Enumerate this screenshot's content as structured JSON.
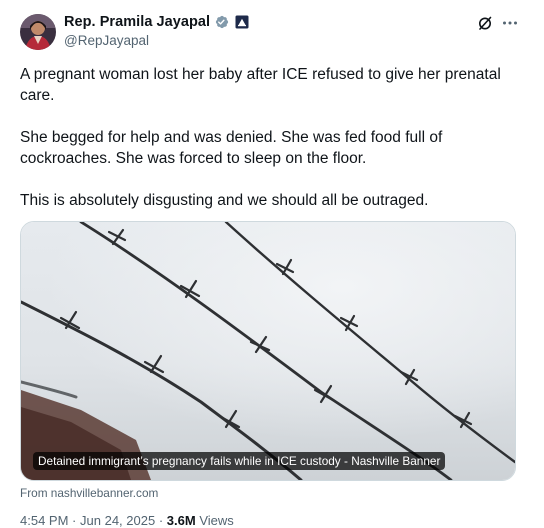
{
  "author": {
    "display_name": "Rep. Pramila Jayapal",
    "handle": "@RepJayapal",
    "verified_icon": "verified-badge-icon",
    "affiliation_icon": "government-badge-icon",
    "avatar_icon": "avatar"
  },
  "actions": {
    "grok_icon": "grok-icon",
    "more_icon": "more-options-icon"
  },
  "tweet": {
    "paragraphs": [
      "A pregnant woman lost her baby after ICE refused to give her prenatal care.",
      "She begged for help and was denied. She was fed food full of cockroaches. She was forced to sleep on the floor.",
      "This is absolutely disgusting and we should all be outraged."
    ]
  },
  "link_card": {
    "caption": "Detained immigrant’s pregnancy fails while in ICE custody - Nashville Banner",
    "source": "From nashvillebanner.com"
  },
  "meta": {
    "time": "4:54 PM",
    "separator": "·",
    "date": "Jun 24, 2025",
    "views_count": "3.6M",
    "views_label": "Views"
  },
  "colors": {
    "text_primary": "#0f1419",
    "text_secondary": "#536471",
    "verified_blue": "#1d9bf0",
    "card_border": "#cfd9de"
  }
}
